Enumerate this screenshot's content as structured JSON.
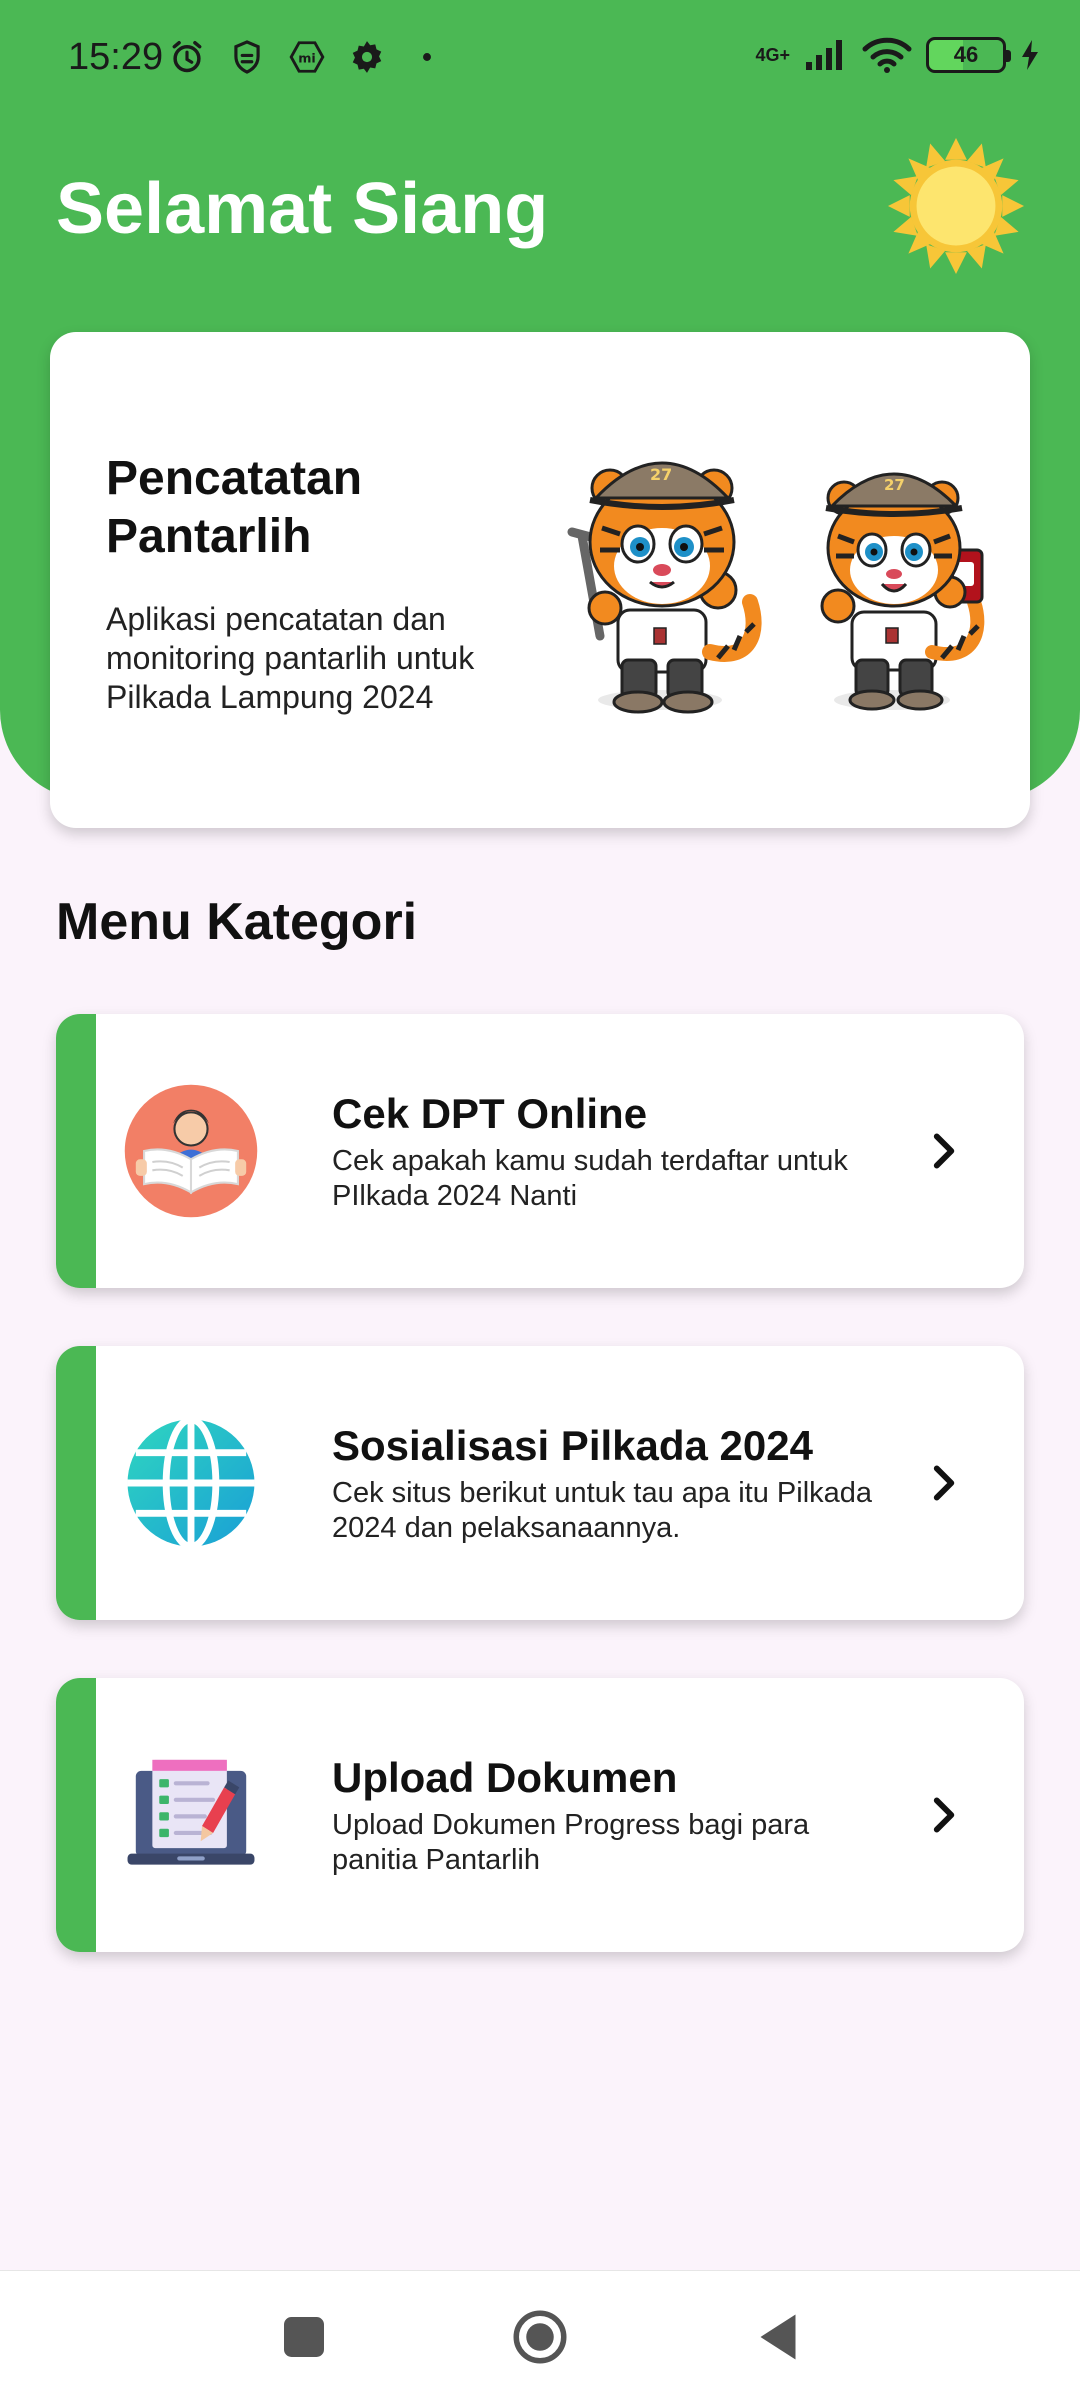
{
  "status_bar": {
    "time": "15:29",
    "network": "4G+",
    "battery": "46",
    "icons": [
      "alarm-icon",
      "shield-icon",
      "mi-icon",
      "settings-icon",
      "dot-icon",
      "signal-icon",
      "wifi-icon",
      "battery-icon",
      "charging-icon"
    ]
  },
  "header": {
    "greeting": "Selamat Siang",
    "weather_icon": "sun-icon",
    "background_color": "#4bb854"
  },
  "hero": {
    "title": "Pencatatan Pantarlih",
    "description": "Aplikasi pencatatan dan monitoring pantarlih untuk Pilkada Lampung 2024",
    "image": "tiger-mascots-illustration"
  },
  "menu": {
    "section_title": "Menu Kategori",
    "accent_color": "#4bb854",
    "items": [
      {
        "title": "Cek DPT Online",
        "description": "Cek apakah kamu sudah terdaftar untuk PIlkada 2024 Nanti",
        "icon": "person-reading-icon"
      },
      {
        "title": "Sosialisasi Pilkada 2024",
        "description": "Cek situs berikut untuk tau apa itu Pilkada 2024 dan pelaksanaannya.",
        "icon": "globe-icon"
      },
      {
        "title": "Upload Dokumen",
        "description": "Upload Dokumen Progress bagi para panitia Pantarlih",
        "icon": "laptop-checklist-icon"
      }
    ]
  },
  "nav_bar": {
    "buttons": [
      "recents-button",
      "home-button",
      "back-button"
    ]
  }
}
